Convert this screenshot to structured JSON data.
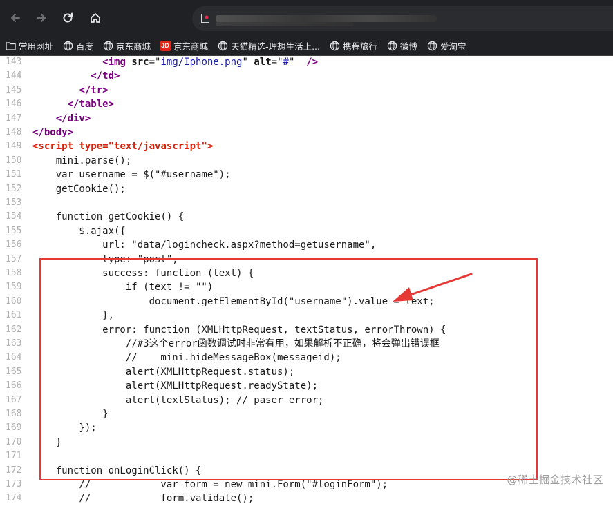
{
  "bookmarks": [
    {
      "label": "常用网址",
      "icon": "folder-icon"
    },
    {
      "label": "百度",
      "icon": "globe-icon"
    },
    {
      "label": "京东商城",
      "icon": "globe-icon"
    },
    {
      "label": "京东商城",
      "icon": "jd-logo-icon"
    },
    {
      "label": "天猫精选-理想生活上...",
      "icon": "globe-icon"
    },
    {
      "label": "携程旅行",
      "icon": "globe-icon"
    },
    {
      "label": "微博",
      "icon": "globe-icon"
    },
    {
      "label": "爱淘宝",
      "icon": "globe-icon"
    }
  ],
  "jd_logo": "JD",
  "colors": {
    "chrome": "#202124",
    "highlight_box": "#e53935",
    "tag": "#7a0080",
    "script_tag": "#d81e06",
    "value": "#1a1aa6"
  },
  "code_lines": [
    {
      "n": "143",
      "text": "            <img src=\"img/Iphone.png\" alt=\"#\" />"
    },
    {
      "n": "144",
      "text": "          </td>"
    },
    {
      "n": "145",
      "text": "        </tr>"
    },
    {
      "n": "146",
      "text": "      </table>"
    },
    {
      "n": "147",
      "text": "    </div>"
    },
    {
      "n": "148",
      "text": "</body>"
    },
    {
      "n": "149",
      "text": "<script type=\"text/javascript\">"
    },
    {
      "n": "150",
      "text": "    mini.parse();"
    },
    {
      "n": "151",
      "text": "    var username = $(\"#username\");"
    },
    {
      "n": "152",
      "text": "    getCookie();"
    },
    {
      "n": "153",
      "text": ""
    },
    {
      "n": "154",
      "text": "    function getCookie() {"
    },
    {
      "n": "155",
      "text": "        $.ajax({"
    },
    {
      "n": "156",
      "text": "            url: \"data/logincheck.aspx?method=getusername\","
    },
    {
      "n": "157",
      "text": "            type: \"post\","
    },
    {
      "n": "158",
      "text": "            success: function (text) {"
    },
    {
      "n": "159",
      "text": "                if (text != \"\")"
    },
    {
      "n": "160",
      "text": "                    document.getElementById(\"username\").value = text;"
    },
    {
      "n": "161",
      "text": "            },"
    },
    {
      "n": "162",
      "text": "            error: function (XMLHttpRequest, textStatus, errorThrown) {"
    },
    {
      "n": "163",
      "text": "                //#3这个error函数调试时非常有用，如果解析不正确，将会弹出错误框"
    },
    {
      "n": "164",
      "text": "                //    mini.hideMessageBox(messageid);"
    },
    {
      "n": "165",
      "text": "                alert(XMLHttpRequest.status);"
    },
    {
      "n": "166",
      "text": "                alert(XMLHttpRequest.readyState);"
    },
    {
      "n": "167",
      "text": "                alert(textStatus); // paser error;"
    },
    {
      "n": "168",
      "text": "            }"
    },
    {
      "n": "169",
      "text": "        });"
    },
    {
      "n": "170",
      "text": "    }"
    },
    {
      "n": "171",
      "text": ""
    },
    {
      "n": "172",
      "text": "    function onLoginClick() {"
    },
    {
      "n": "173",
      "text": "        //            var form = new mini.Form(\"#loginForm\");"
    },
    {
      "n": "174",
      "text": "        //            form.validate();"
    }
  ],
  "watermark": "@稀土掘金技术社区"
}
